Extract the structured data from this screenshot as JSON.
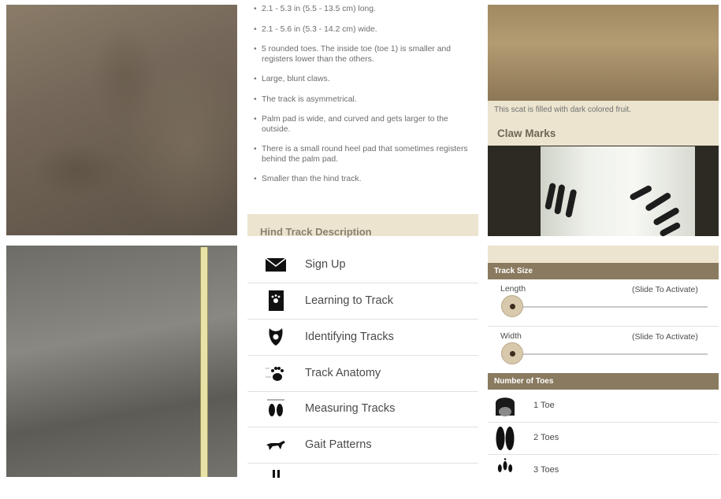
{
  "left_column": {
    "photos": [
      "sand-track-photo",
      "mud-track-photo-with-tape"
    ]
  },
  "front_track": {
    "bullets": [
      "2.1 - 5.3 in (5.5 - 13.5 cm) long.",
      "2.1 - 5.6 in (5.3 - 14.2 cm) wide.",
      "5 rounded toes. The inside toe (toe 1) is smaller and registers lower than the others.",
      "Large, blunt claws.",
      "The track is asymmetrical.",
      "Palm pad is wide, and curved and gets larger to the outside.",
      "There is a small round heel pad that sometimes registers behind the palm pad.",
      "Smaller than the hind track."
    ],
    "hind_heading": "Hind Track Description"
  },
  "menu": {
    "items": [
      {
        "label": "Sign Up",
        "icon": "envelope-icon"
      },
      {
        "label": "Learning to Track",
        "icon": "book-icon"
      },
      {
        "label": "Identifying Tracks",
        "icon": "track-id-icon"
      },
      {
        "label": "Track Anatomy",
        "icon": "paw-anatomy-icon"
      },
      {
        "label": "Measuring Tracks",
        "icon": "ruler-prints-icon"
      },
      {
        "label": "Gait Patterns",
        "icon": "running-animal-icon"
      },
      {
        "label": "",
        "icon": "partial-icon"
      }
    ]
  },
  "scat_panel": {
    "caption": "This scat is filled with dark colored fruit.",
    "claw_heading": "Claw Marks"
  },
  "filter_panel": {
    "track_size_header": "Track Size",
    "length_label": "Length",
    "width_label": "Width",
    "slide_hint": "(Slide To Activate)",
    "toes_header": "Number of Toes",
    "toes": [
      "1 Toe",
      "2 Toes",
      "3 Toes"
    ]
  },
  "colors": {
    "beige": "#ece4cf",
    "header_brown": "#8a7a5f"
  }
}
